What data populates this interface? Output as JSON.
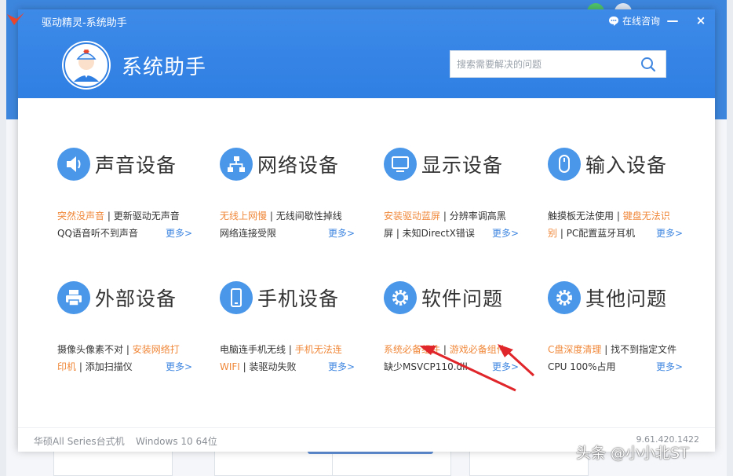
{
  "window": {
    "title": "驱动精灵-系统助手",
    "consult_label": "在线咨询",
    "minimize_label": "—",
    "close_label": "×"
  },
  "brand": {
    "title": "系统助手"
  },
  "search": {
    "placeholder": "搜索需要解决的问题"
  },
  "categories": [
    {
      "title": "声音设备",
      "icon": "speaker-icon",
      "line1": [
        {
          "text": "突然没声音",
          "hot": true
        },
        {
          "text": " | ",
          "sep": true
        },
        {
          "text": "更新驱动无声音",
          "hot": false
        }
      ],
      "line2": [
        {
          "text": "QQ语音听不到声音",
          "hot": false
        }
      ],
      "more": "更多>"
    },
    {
      "title": "网络设备",
      "icon": "network-icon",
      "line1": [
        {
          "text": "无线上网慢",
          "hot": true
        },
        {
          "text": " | ",
          "sep": true
        },
        {
          "text": "无线间歇性掉线",
          "hot": false
        }
      ],
      "line2": [
        {
          "text": "网络连接受限",
          "hot": false
        }
      ],
      "more": "更多>"
    },
    {
      "title": "显示设备",
      "icon": "monitor-icon",
      "line1": [
        {
          "text": "安装驱动蓝屏",
          "hot": true
        },
        {
          "text": " | ",
          "sep": true
        },
        {
          "text": "分辨率调高黑",
          "hot": false
        }
      ],
      "line2": [
        {
          "text": "屏 | 未知DirectX错误",
          "hot": false
        }
      ],
      "more": "更多>"
    },
    {
      "title": "输入设备",
      "icon": "mouse-icon",
      "line1": [
        {
          "text": "触摸板无法使用",
          "hot": false
        },
        {
          "text": " | ",
          "sep": true
        },
        {
          "text": "键盘无法识",
          "hot": true
        }
      ],
      "line2": [
        {
          "text": "别",
          "hot": true
        },
        {
          "text": " | ",
          "sep": true
        },
        {
          "text": "PC配置蓝牙耳机",
          "hot": false
        }
      ],
      "more": "更多>"
    },
    {
      "title": "外部设备",
      "icon": "printer-icon",
      "line1": [
        {
          "text": "摄像头像素不对",
          "hot": false
        },
        {
          "text": " | ",
          "sep": true
        },
        {
          "text": "安装网络打",
          "hot": true
        }
      ],
      "line2": [
        {
          "text": "印机",
          "hot": true
        },
        {
          "text": " | ",
          "sep": true
        },
        {
          "text": "添加扫描仪",
          "hot": false
        }
      ],
      "more": "更多>"
    },
    {
      "title": "手机设备",
      "icon": "phone-icon",
      "line1": [
        {
          "text": "电脑连手机无线",
          "hot": false
        },
        {
          "text": " | ",
          "sep": true
        },
        {
          "text": "手机无法连",
          "hot": true
        }
      ],
      "line2": [
        {
          "text": "WIFI",
          "hot": true
        },
        {
          "text": " | ",
          "sep": true
        },
        {
          "text": "装驱动失败",
          "hot": false
        }
      ],
      "more": "更多>"
    },
    {
      "title": "软件问题",
      "icon": "gear-icon",
      "line1": [
        {
          "text": "系统必备组件",
          "hot": true
        },
        {
          "text": " | ",
          "sep": true
        },
        {
          "text": "游戏必备组件",
          "hot": true
        }
      ],
      "line2": [
        {
          "text": "缺少MSVCP110.dll",
          "hot": false
        }
      ],
      "more": "更多>"
    },
    {
      "title": "其他问题",
      "icon": "gear-icon",
      "line1": [
        {
          "text": "C盘深度清理",
          "hot": true
        },
        {
          "text": " | ",
          "sep": true
        },
        {
          "text": "找不到指定文件",
          "hot": false
        }
      ],
      "line2": [
        {
          "text": "CPU 100%占用",
          "hot": false
        }
      ],
      "more": "更多>"
    }
  ],
  "footer": {
    "pc_model": "华硕All Series台式机",
    "os": "Windows 10 64位",
    "version": "9.61.420.1422"
  },
  "watermark": "头条 @小小北ST",
  "colors": {
    "accent": "#2f7fe3",
    "hot_link": "#f0883a",
    "more_link": "#3f86e0",
    "arrow": "#e0262a"
  }
}
